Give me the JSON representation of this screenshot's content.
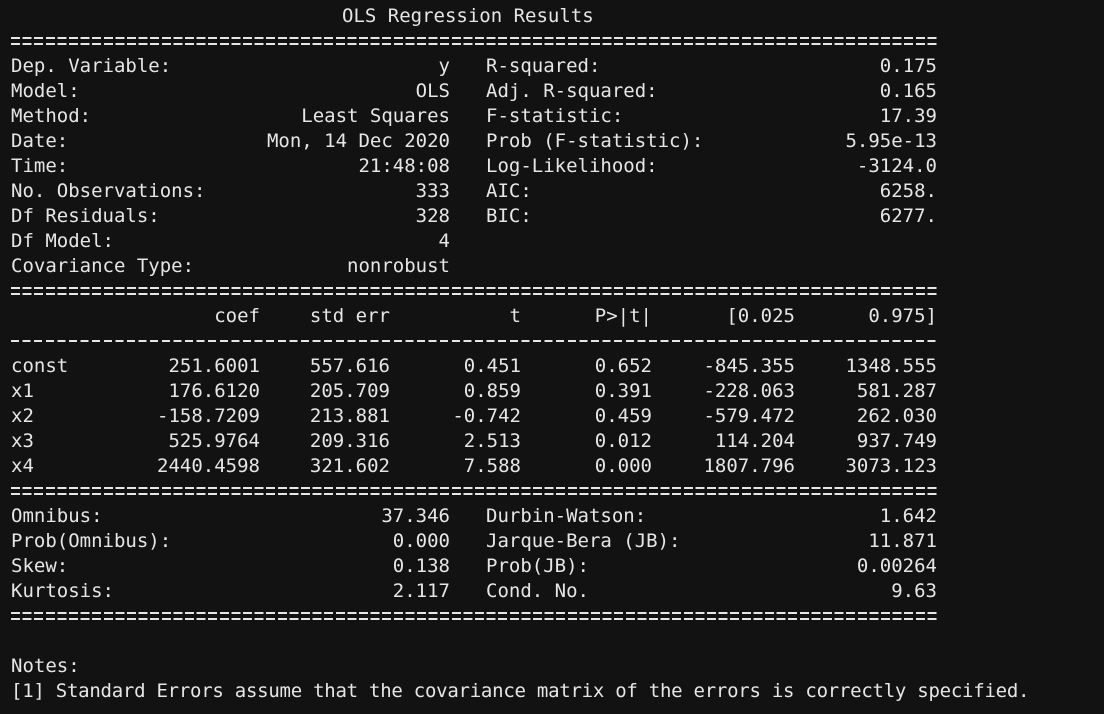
{
  "title": "OLS Regression Results",
  "summary_left": [
    {
      "label": "Dep. Variable:",
      "value": "y"
    },
    {
      "label": "Model:",
      "value": "OLS"
    },
    {
      "label": "Method:",
      "value": "Least Squares"
    },
    {
      "label": "Date:",
      "value": "Mon, 14 Dec 2020"
    },
    {
      "label": "Time:",
      "value": "21:48:08"
    },
    {
      "label": "No. Observations:",
      "value": "333"
    },
    {
      "label": "Df Residuals:",
      "value": "328"
    },
    {
      "label": "Df Model:",
      "value": "4"
    },
    {
      "label": "Covariance Type:",
      "value": "nonrobust"
    }
  ],
  "summary_right": [
    {
      "label": "R-squared:",
      "value": "0.175"
    },
    {
      "label": "Adj. R-squared:",
      "value": "0.165"
    },
    {
      "label": "F-statistic:",
      "value": "17.39"
    },
    {
      "label": "Prob (F-statistic):",
      "value": "5.95e-13"
    },
    {
      "label": "Log-Likelihood:",
      "value": "-3124.0"
    },
    {
      "label": "AIC:",
      "value": "6258."
    },
    {
      "label": "BIC:",
      "value": "6277."
    }
  ],
  "coef_table": {
    "headers": [
      "coef",
      "std err",
      "t",
      "P>|t|",
      "[0.025",
      "0.975]"
    ],
    "rows": [
      {
        "name": "const",
        "cells": [
          "251.6001",
          "557.616",
          "0.451",
          "0.652",
          "-845.355",
          "1348.555"
        ]
      },
      {
        "name": "x1",
        "cells": [
          "176.6120",
          "205.709",
          "0.859",
          "0.391",
          "-228.063",
          "581.287"
        ]
      },
      {
        "name": "x2",
        "cells": [
          "-158.7209",
          "213.881",
          "-0.742",
          "0.459",
          "-579.472",
          "262.030"
        ]
      },
      {
        "name": "x3",
        "cells": [
          "525.9764",
          "209.316",
          "2.513",
          "0.012",
          "114.204",
          "937.749"
        ]
      },
      {
        "name": "x4",
        "cells": [
          "2440.4598",
          "321.602",
          "7.588",
          "0.000",
          "1807.796",
          "3073.123"
        ]
      }
    ]
  },
  "diagnostics_left": [
    {
      "label": "Omnibus:",
      "value": "37.346"
    },
    {
      "label": "Prob(Omnibus):",
      "value": "0.000"
    },
    {
      "label": "Skew:",
      "value": "0.138"
    },
    {
      "label": "Kurtosis:",
      "value": "2.117"
    }
  ],
  "diagnostics_right": [
    {
      "label": "Durbin-Watson:",
      "value": "1.642"
    },
    {
      "label": "Jarque-Bera (JB):",
      "value": "11.871"
    },
    {
      "label": "Prob(JB):",
      "value": "0.00264"
    },
    {
      "label": "Cond. No.",
      "value": "9.63"
    }
  ],
  "notes": {
    "heading": "Notes:",
    "items": [
      "[1] Standard Errors assume that the covariance matrix of the errors is correctly specified."
    ]
  }
}
